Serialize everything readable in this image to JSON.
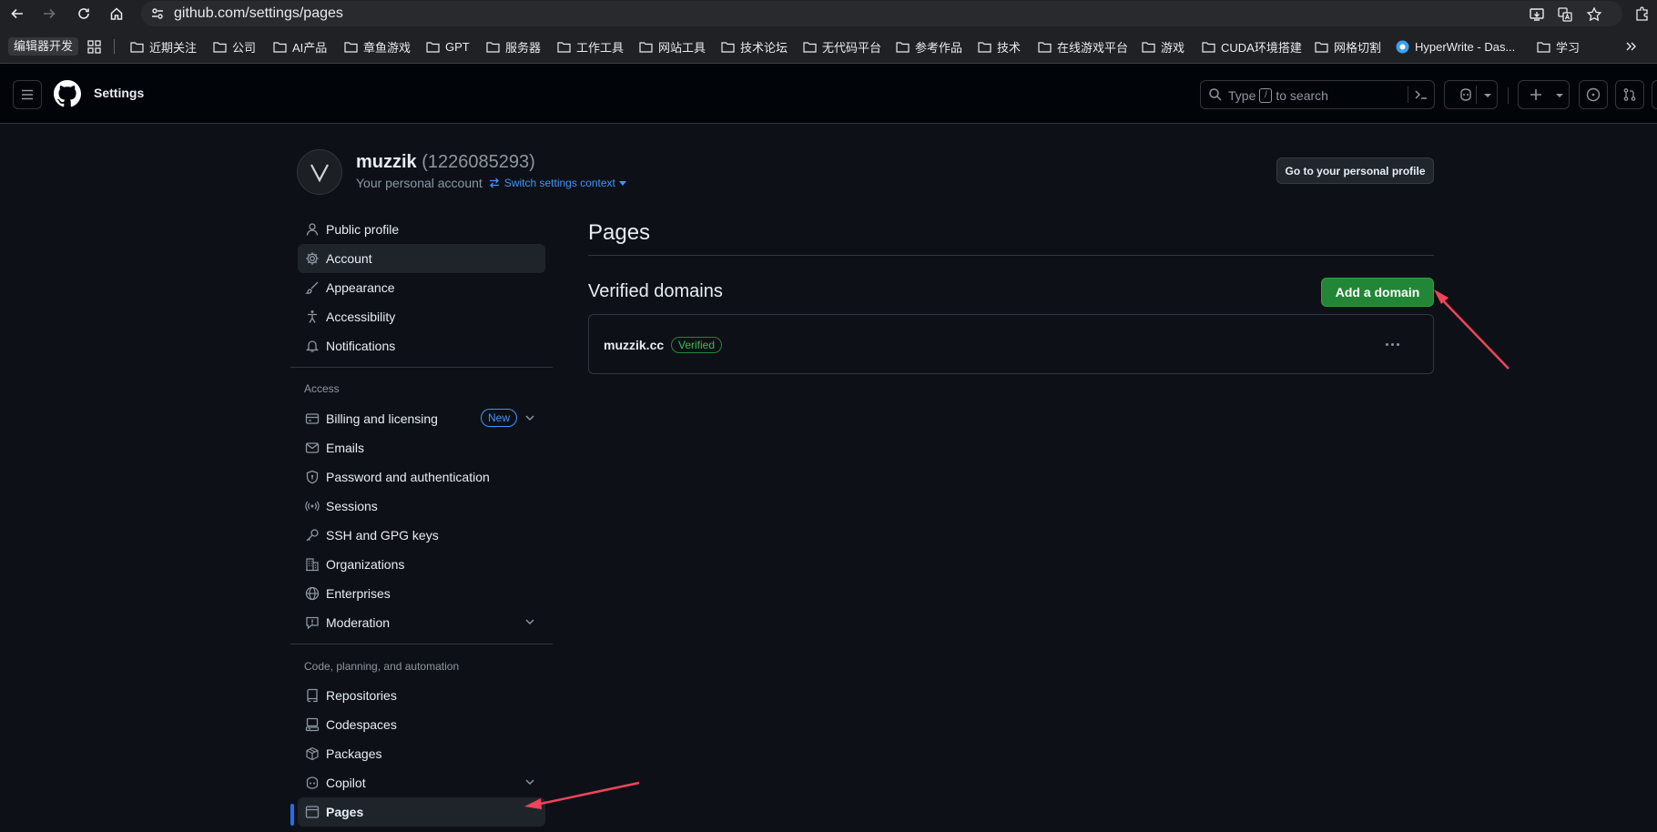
{
  "browser": {
    "url": "github.com/settings/pages",
    "bookmarks": [
      "编辑器开发",
      "近期关注",
      "公司",
      "AI产品",
      "章鱼游戏",
      "GPT",
      "服务器",
      "工作工具",
      "网站工具",
      "技术论坛",
      "无代码平台",
      "参考作品",
      "技术",
      "在线游戏平台",
      "游戏",
      "CUDA环境搭建",
      "网格切割",
      "HyperWrite - Das...",
      "学习"
    ]
  },
  "header": {
    "title": "Settings",
    "search_placeholder_pre": "Type",
    "search_key": "/",
    "search_placeholder_post": "to search"
  },
  "account": {
    "name": "muzzik",
    "id": "(1226085293)",
    "subtitle": "Your personal account",
    "switch_context": "Switch settings context",
    "profile_button": "Go to your personal profile"
  },
  "sidebar": {
    "top_items": [
      "Public profile",
      "Account",
      "Appearance",
      "Accessibility",
      "Notifications"
    ],
    "access_heading": "Access",
    "access_items": [
      "Billing and licensing",
      "Emails",
      "Password and authentication",
      "Sessions",
      "SSH and GPG keys",
      "Organizations",
      "Enterprises",
      "Moderation"
    ],
    "new_badge": "New",
    "code_heading": "Code, planning, and automation",
    "code_items": [
      "Repositories",
      "Codespaces",
      "Packages",
      "Copilot",
      "Pages"
    ]
  },
  "main": {
    "title": "Pages",
    "section_title": "Verified domains",
    "add_button": "Add a domain",
    "domains": [
      {
        "name": "muzzik.cc",
        "status": "Verified"
      }
    ]
  },
  "colors": {
    "accent_blue": "#4493f8",
    "success_green": "#238636",
    "annotation_red": "#f0445a"
  }
}
